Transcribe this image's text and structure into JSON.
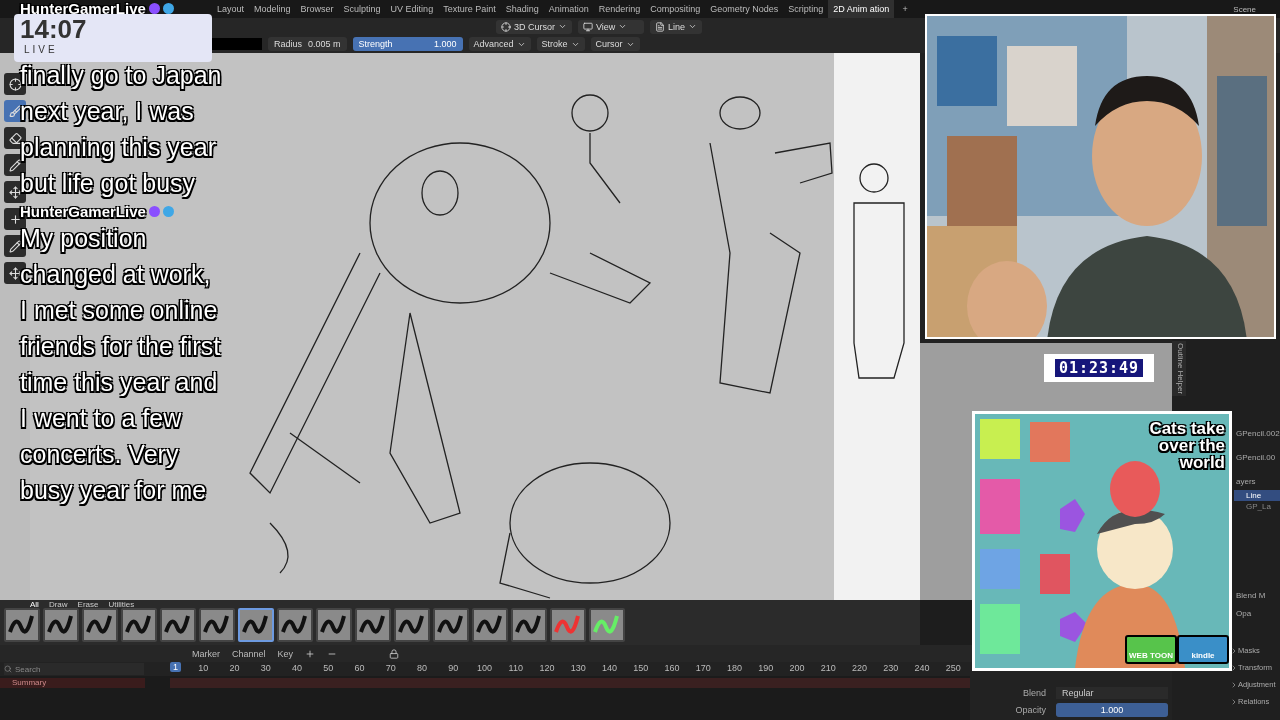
{
  "workspace_tabs": [
    {
      "label": "Layout",
      "selected": false
    },
    {
      "label": "Modeling",
      "selected": false
    },
    {
      "label": "Browser",
      "selected": false
    },
    {
      "label": "Sculpting",
      "selected": false
    },
    {
      "label": "UV Editing",
      "selected": false
    },
    {
      "label": "Texture Paint",
      "selected": false
    },
    {
      "label": "Shading",
      "selected": false
    },
    {
      "label": "Animation",
      "selected": false
    },
    {
      "label": "Rendering",
      "selected": false
    },
    {
      "label": "Compositing",
      "selected": false
    },
    {
      "label": "Geometry Nodes",
      "selected": false
    },
    {
      "label": "Scripting",
      "selected": false
    },
    {
      "label": "2D Anim ation",
      "selected": true
    }
  ],
  "add_tab": "+",
  "scene": "Scene",
  "header_menus": [
    {
      "label": "3D Cursor"
    },
    {
      "label": "View"
    },
    {
      "label": "Line"
    }
  ],
  "tool_settings": {
    "radius_label": "Radius",
    "radius_value": "0.005 m",
    "strength": {
      "label": "Strength",
      "value": "1.000",
      "level": 1
    },
    "menus": [
      "Advanced",
      "Stroke",
      "Cursor"
    ]
  },
  "toolbar_tools": [
    {
      "selected": false
    },
    {
      "selected": true
    },
    {
      "selected": false
    },
    {
      "selected": false
    },
    {
      "selected": false
    },
    {
      "selected": false
    },
    {
      "selected": false
    },
    {
      "selected": false
    }
  ],
  "brush_tabs": [
    {
      "label": "All",
      "selected": true
    },
    {
      "label": "Draw",
      "selected": false
    },
    {
      "label": "Erase",
      "selected": false
    },
    {
      "label": "Utilities",
      "selected": false
    }
  ],
  "brushes": [
    {
      "selected": false
    },
    {
      "selected": false
    },
    {
      "selected": false
    },
    {
      "selected": false
    },
    {
      "selected": false
    },
    {
      "selected": false
    },
    {
      "selected": true
    },
    {
      "selected": false
    },
    {
      "selected": false
    },
    {
      "selected": false
    },
    {
      "selected": false
    },
    {
      "selected": false
    },
    {
      "selected": false
    },
    {
      "selected": false
    },
    {
      "selected": false
    },
    {
      "selected": false
    }
  ],
  "timeline": {
    "menus": [
      "Marker",
      "Channel",
      "Key"
    ],
    "search_placeholder": "Search",
    "summary": "Summary",
    "current_frame": "1",
    "frames": [
      "10",
      "20",
      "30",
      "40",
      "50",
      "60",
      "70",
      "80",
      "90",
      "100",
      "110",
      "120",
      "130",
      "140",
      "150",
      "160",
      "170",
      "180",
      "190",
      "200",
      "210",
      "220",
      "230",
      "240",
      "250"
    ]
  },
  "right_panel": {
    "side_tab": "Outline Helper",
    "objects": [
      "GPencil.002",
      "GPencil.00"
    ],
    "layers_label": "ayers",
    "layers": [
      {
        "label": "Line",
        "selected": true
      },
      {
        "label": "GP_La",
        "selected": false
      }
    ],
    "props": [
      "Blend M",
      "Opa"
    ],
    "sections": [
      "Masks",
      "Transform",
      "Adjustment",
      "Relations"
    ],
    "blend_label": "Blend",
    "blend_value": "Regular",
    "opacity": {
      "label": "Opacity",
      "value": "1.000",
      "level": 1
    }
  },
  "stream": {
    "clock": "14:07",
    "live": "LIVE",
    "timer": "01:23:49",
    "chat": [
      {
        "user": "HunterGamerLive",
        "text": "finally go to Japan next year, I was planning this year but life got busy"
      },
      {
        "user": "HunterGamerLive",
        "text": "My position changed at work, I met some online friends for the first time this year and I went to a few concerts. Very busy year for me"
      }
    ],
    "ad": {
      "title": "Cats take over the world",
      "badges": [
        "WEB TOON",
        "kindle"
      ]
    }
  }
}
